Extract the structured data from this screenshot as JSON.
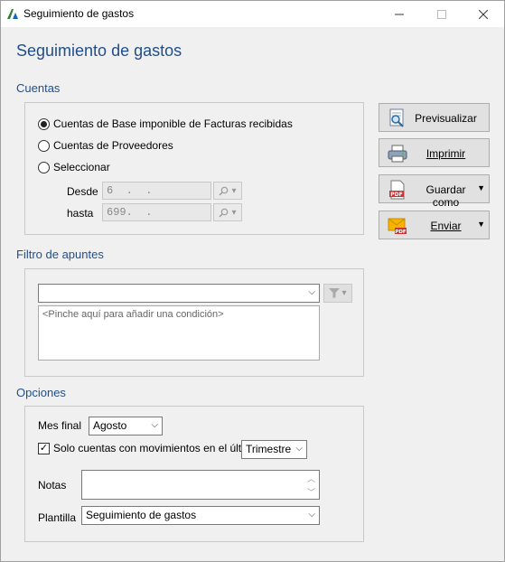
{
  "window": {
    "title": "Seguimiento de gastos"
  },
  "page": {
    "title": "Seguimiento de gastos"
  },
  "cuentas": {
    "title": "Cuentas",
    "options": [
      {
        "label": "Cuentas de Base imponible de Facturas recibidas",
        "selected": true
      },
      {
        "label": "Cuentas de Proveedores",
        "selected": false
      },
      {
        "label": "Seleccionar",
        "selected": false
      }
    ],
    "desde_label": "Desde",
    "desde_value": "6  .  .",
    "hasta_label": "hasta",
    "hasta_value": "699.  ."
  },
  "actions": {
    "previsualizar": "Previsualizar",
    "imprimir": "Imprimir",
    "guardar_como": "Guardar como",
    "enviar": "Enviar"
  },
  "filtro": {
    "title": "Filtro de apuntes",
    "select_value": "",
    "condition_hint": "<Pinche aquí para añadir una condición>"
  },
  "opciones": {
    "title": "Opciones",
    "mes_final_label": "Mes final",
    "mes_final_value": "Agosto",
    "solo_cuentas_label": "Solo cuentas con movimientos en el último",
    "solo_cuentas_checked": true,
    "periodo_value": "Trimestre",
    "notas_label": "Notas",
    "notas_value": "",
    "plantilla_label": "Plantilla",
    "plantilla_value": "Seguimiento de gastos"
  },
  "colors": {
    "accent": "#1f4e8c"
  },
  "icons": {
    "app": "app-logo-icon",
    "previsualizar": "magnifier-document-icon",
    "imprimir": "printer-icon",
    "guardar_como": "pdf-document-icon",
    "enviar": "pdf-envelope-icon"
  }
}
